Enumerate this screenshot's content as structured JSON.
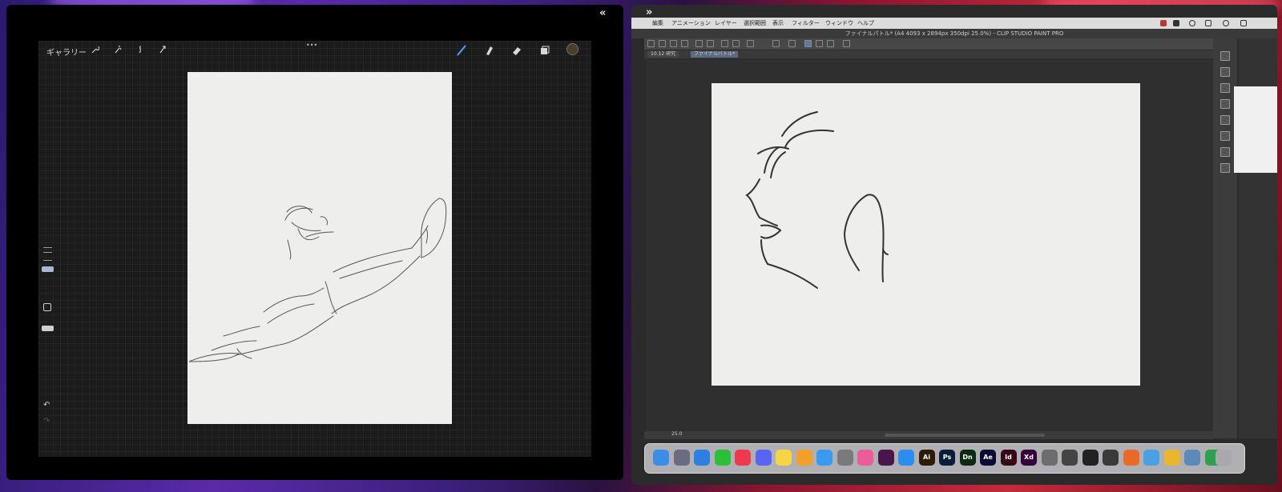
{
  "procreate": {
    "collapse_glyph": "«",
    "gallery_label": "ギャラリー",
    "more_glyph": "•••",
    "tools": [
      "wrench-icon",
      "magic-wand-icon",
      "selection-icon",
      "transform-icon"
    ],
    "right_tools": [
      "brush-icon",
      "smudge-icon",
      "eraser-icon",
      "layers-icon",
      "color-swatch"
    ],
    "color_swatch": "#4a3f2a",
    "undo_glyph": "↶",
    "redo_glyph": "↷"
  },
  "clip_studio": {
    "expand_glyph": "»",
    "menu": [
      "編集",
      "アニメーション",
      "レイヤー",
      "選択範囲",
      "表示",
      "フィルター",
      "ウィンドウ",
      "ヘルプ"
    ],
    "window_title": "ファイナルパトル* (A4 4093 x 2894px 350dpi 25.0%) - CLIP STUDIO PAINT PRO",
    "tabs": [
      "10.12 研究",
      "ファイナルバトル*"
    ],
    "zoom": "25.0"
  },
  "dock": {
    "apps": [
      {
        "name": "finder",
        "label": "",
        "color": "#3a8ee6"
      },
      {
        "name": "launchpad",
        "label": "",
        "color": "#6c6c80"
      },
      {
        "name": "safari",
        "label": "",
        "color": "#2f7fe0"
      },
      {
        "name": "line",
        "label": "",
        "color": "#2bbf3a"
      },
      {
        "name": "music",
        "label": "",
        "color": "#f0384f"
      },
      {
        "name": "discord",
        "label": "",
        "color": "#5865f2"
      },
      {
        "name": "notes",
        "label": "",
        "color": "#f5d445"
      },
      {
        "name": "pencil",
        "label": "",
        "color": "#f2a02a"
      },
      {
        "name": "mail",
        "label": "",
        "color": "#3a9af0"
      },
      {
        "name": "settings",
        "label": "",
        "color": "#7a7a7a"
      },
      {
        "name": "photos",
        "label": "",
        "color": "#e85d9a"
      },
      {
        "name": "slack",
        "label": "",
        "color": "#4a154b"
      },
      {
        "name": "appstore",
        "label": "",
        "color": "#2d8cf0"
      },
      {
        "name": "illustrator",
        "label": "Ai",
        "color": "#2e1a05"
      },
      {
        "name": "photoshop",
        "label": "Ps",
        "color": "#071d3a"
      },
      {
        "name": "dimension",
        "label": "Dn",
        "color": "#0b2a12"
      },
      {
        "name": "after-effects",
        "label": "Ae",
        "color": "#0a0a35"
      },
      {
        "name": "indesign",
        "label": "Id",
        "color": "#3a0616"
      },
      {
        "name": "xd",
        "label": "Xd",
        "color": "#35003a"
      },
      {
        "name": "clip-studio-1",
        "label": "",
        "color": "#6d6d6d"
      },
      {
        "name": "clip-studio-2",
        "label": "",
        "color": "#444444"
      },
      {
        "name": "clip-studio-paint",
        "label": "",
        "color": "#222222"
      },
      {
        "name": "app-b",
        "label": "",
        "color": "#3a3a3a"
      },
      {
        "name": "app-c",
        "label": "",
        "color": "#e86a2a"
      },
      {
        "name": "app-d",
        "label": "",
        "color": "#4aa0e0"
      },
      {
        "name": "chrome",
        "label": "",
        "color": "#e9b630"
      },
      {
        "name": "preview",
        "label": "",
        "color": "#5a8ab5"
      },
      {
        "name": "chrome-2",
        "label": "",
        "color": "#2fa050"
      },
      {
        "name": "trash",
        "label": "",
        "color": "#a8a8ad"
      }
    ]
  }
}
